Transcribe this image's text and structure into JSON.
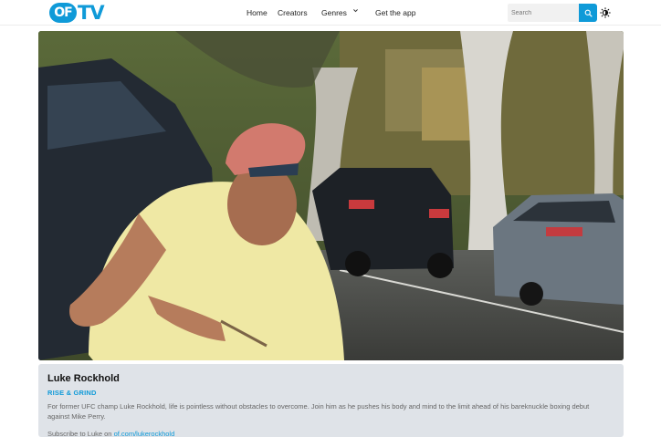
{
  "brand": {
    "logo_text_1": "OF",
    "logo_text_2": "TV"
  },
  "nav": {
    "items": [
      {
        "label": "Home"
      },
      {
        "label": "Creators"
      },
      {
        "label": "Genres"
      },
      {
        "label": "Get the app"
      }
    ]
  },
  "search": {
    "placeholder": "Search"
  },
  "icons": {
    "search": "search-icon",
    "theme": "sun-icon",
    "genres_dropdown": "chevron-down-icon"
  },
  "colors": {
    "accent": "#0f9ad8",
    "panel": "#dfe3e8"
  },
  "video": {
    "subject": "man-in-yellow-shirt-running"
  },
  "episode": {
    "title": "Luke Rockhold",
    "show": "RISE & GRIND",
    "description": "For former UFC champ Luke Rockhold, life is pointless without obstacles to overcome. Join him as he pushes his body and mind to the limit ahead of his bareknuckle boxing debut against Mike Perry.",
    "subscribe_prefix": "Subscribe to Luke on",
    "subscribe_link": "of.com/lukerockhold"
  }
}
